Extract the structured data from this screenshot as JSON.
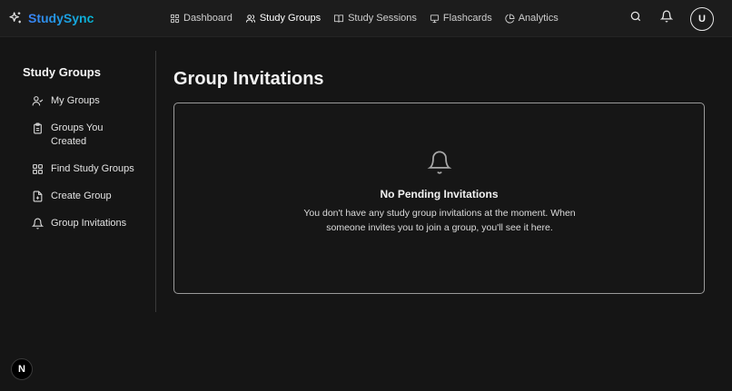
{
  "brand": {
    "name": "StudySync",
    "icon": "sparkles-icon"
  },
  "nav": {
    "items": [
      {
        "label": "Dashboard",
        "icon": "grid-icon"
      },
      {
        "label": "Study Groups",
        "icon": "users-icon"
      },
      {
        "label": "Study Sessions",
        "icon": "book-open-icon"
      },
      {
        "label": "Flashcards",
        "icon": "presentation-icon"
      },
      {
        "label": "Analytics",
        "icon": "pie-chart-icon"
      }
    ]
  },
  "header": {
    "avatar_initial": "U"
  },
  "sidebar": {
    "title": "Study Groups",
    "items": [
      {
        "label": "My Groups",
        "icon": "user-check-icon"
      },
      {
        "label": "Groups You Created",
        "icon": "clipboard-icon"
      },
      {
        "label": "Find Study Groups",
        "icon": "grid-icon"
      },
      {
        "label": "Create Group",
        "icon": "file-plus-icon"
      },
      {
        "label": "Group Invitations",
        "icon": "bell-icon"
      }
    ]
  },
  "main": {
    "title": "Group Invitations",
    "empty_state": {
      "title": "No Pending Invitations",
      "message": "You don't have any study group invitations at the moment. When someone invites you to join a group, you'll see it here."
    }
  },
  "badge": {
    "label": "N"
  }
}
